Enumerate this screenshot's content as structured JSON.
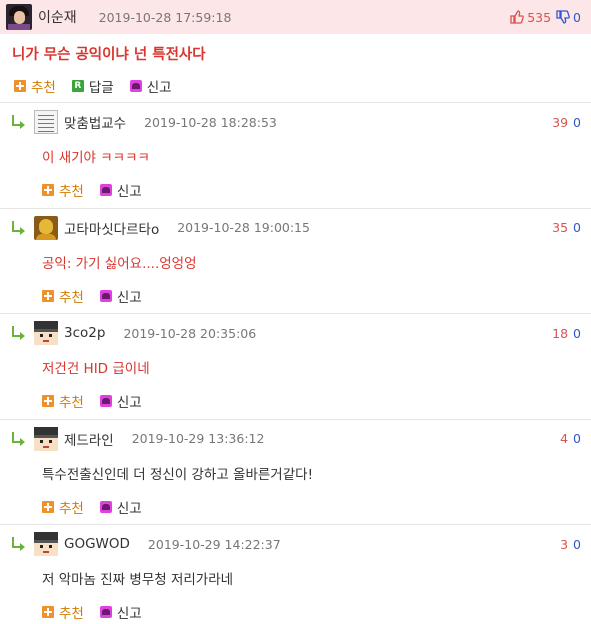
{
  "main": {
    "nick": "이순재",
    "date": "2019-10-28 17:59:18",
    "up_count": "535",
    "down_count": "0",
    "title": "니가 무슨 공익이냐 넌 특전사다",
    "actions": {
      "recommend": "추천",
      "reply": "답글",
      "report": "신고"
    }
  },
  "replies": [
    {
      "nick": "맞춤법교수",
      "date": "2019-10-28 18:28:53",
      "up": "39",
      "down": "0",
      "text": "이 새기야 ㅋㅋㅋㅋ",
      "recommend": "추천",
      "report": "신고"
    },
    {
      "nick": "고타마싯다르타o",
      "date": "2019-10-28 19:00:15",
      "up": "35",
      "down": "0",
      "text": "공익: 가기 싫어요....엉엉엉",
      "recommend": "추천",
      "report": "신고"
    },
    {
      "nick": "3co2p",
      "date": "2019-10-28 20:35:06",
      "up": "18",
      "down": "0",
      "text": "저건건 HID 급이네",
      "recommend": "추천",
      "report": "신고"
    },
    {
      "nick": "제드라인",
      "date": "2019-10-29 13:36:12",
      "up": "4",
      "down": "0",
      "text": "특수전출신인데 더 정신이 강하고 올바른거같다!",
      "recommend": "추천",
      "report": "신고"
    },
    {
      "nick": "GOGWOD",
      "date": "2019-10-29 14:22:37",
      "up": "3",
      "down": "0",
      "text": "저 악마놈 진짜 병무청 저리가라네",
      "recommend": "추천",
      "report": "신고"
    }
  ],
  "icons": {
    "recommend": "plus-square-icon",
    "reply": "r-square-icon",
    "report": "siren-icon",
    "vote_up": "thumbs-up-icon",
    "vote_down": "thumbs-down-icon",
    "reply_marker": "reply-arrow-icon"
  },
  "colors": {
    "header_bg": "#fde6e8",
    "accent_red": "#d9362f",
    "down_blue": "#3355cc",
    "reply_green": "#69b33a"
  }
}
